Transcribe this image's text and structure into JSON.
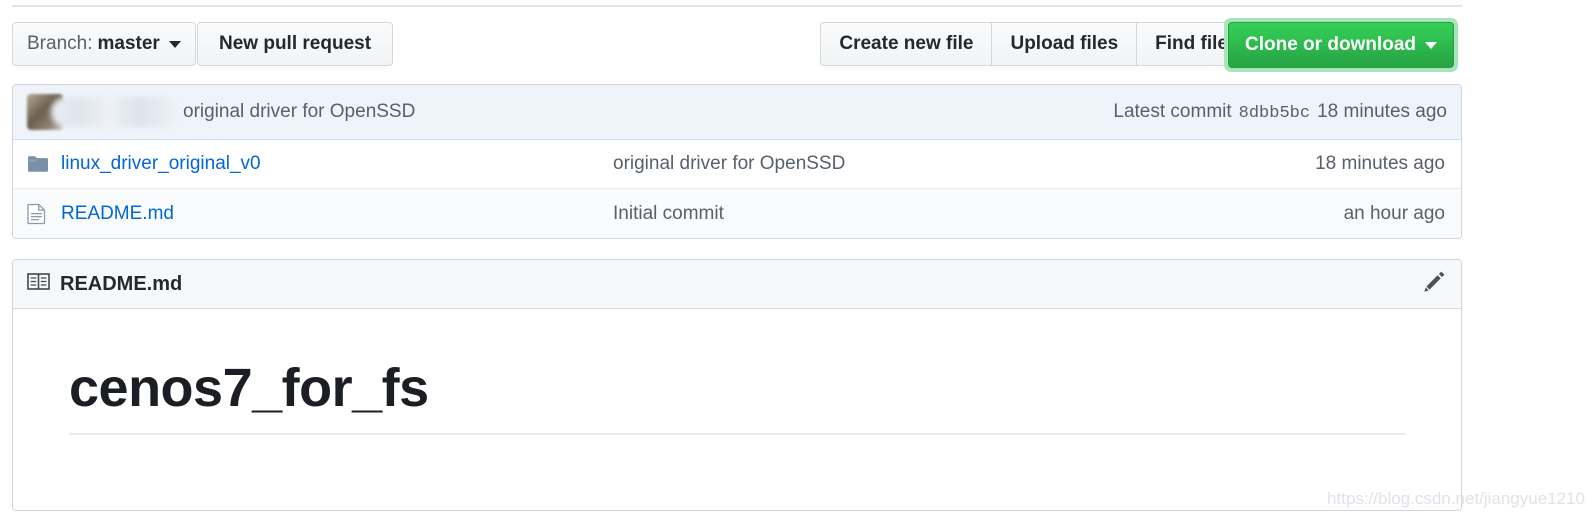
{
  "toolbar": {
    "branch_prefix": "Branch:",
    "branch_name": "master",
    "new_pull_request": "New pull request",
    "create_new_file": "Create new file",
    "upload_files": "Upload files",
    "find_file": "Find file",
    "clone_or_download": "Clone or download",
    "clone_button_color": "#2cbe4e",
    "focus_ring_color": "#a9e5ba"
  },
  "commit_bar": {
    "author": "",
    "message": "original driver for OpenSSD",
    "latest_commit_label": "Latest commit",
    "sha": "8dbb5bc",
    "time": "18 minutes ago",
    "background_color": "#eff4fb"
  },
  "files": {
    "rows": [
      {
        "icon": "folder-icon",
        "name": "linux_driver_original_v0",
        "message": "original driver for OpenSSD",
        "time": "18 minutes ago"
      },
      {
        "icon": "file-icon",
        "name": "README.md",
        "message": "Initial commit",
        "time": "an hour ago"
      }
    ],
    "link_color": "#0366d6"
  },
  "readme": {
    "header_title": "README.md",
    "header_icon": "book-icon",
    "edit_icon": "pencil-icon",
    "heading": "cenos7_for_fs"
  },
  "watermark": {
    "text": "https://blog.csdn.net/jiangyue1210"
  }
}
